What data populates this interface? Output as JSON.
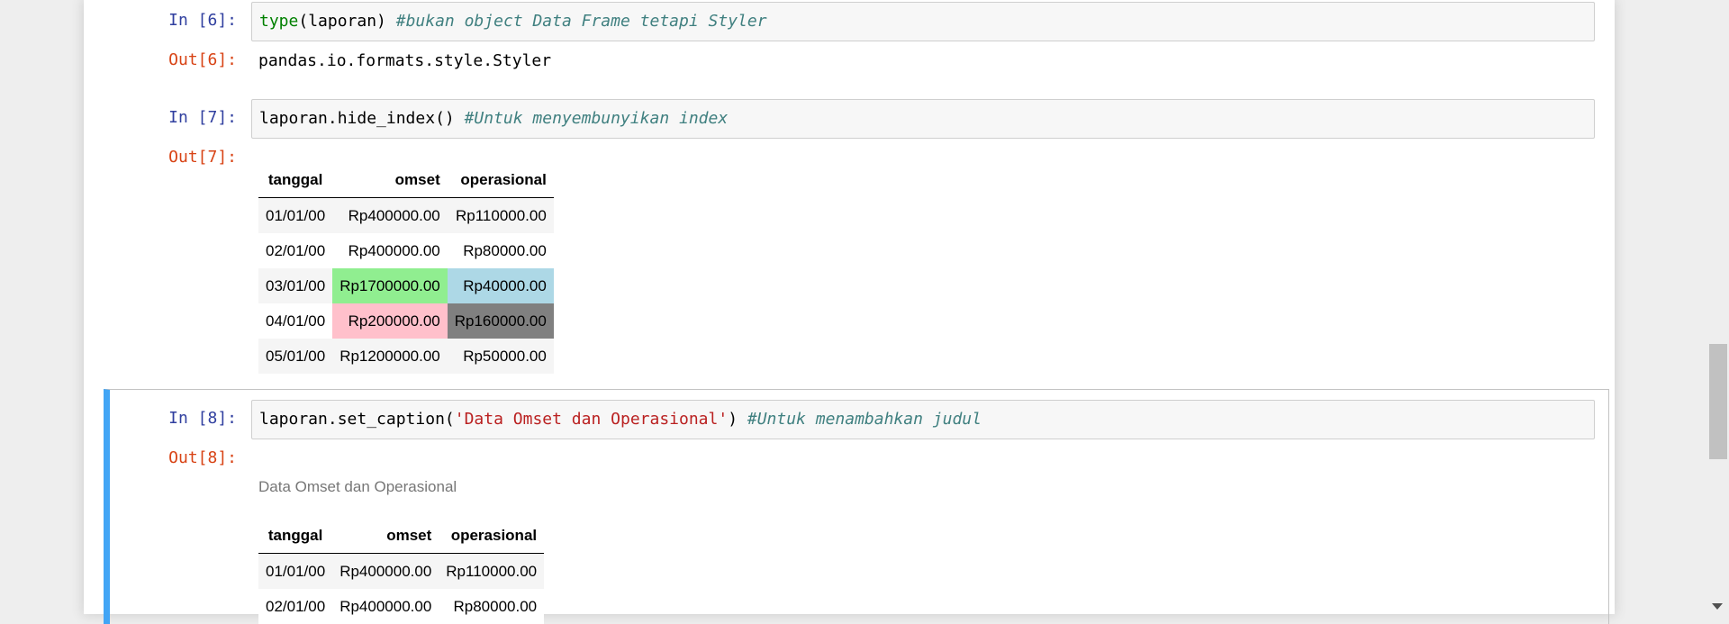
{
  "cells": {
    "c6": {
      "in_prompt": "In [6]:",
      "code_builtin": "type",
      "code_rest": "(laporan) ",
      "code_comment": "#bukan object Data Frame tetapi Styler",
      "out_prompt": "Out[6]:",
      "output_text": "pandas.io.formats.style.Styler"
    },
    "c7": {
      "in_prompt": "In [7]:",
      "code_rest": "laporan.hide_index() ",
      "code_comment": "#Untuk menyembunyikan index",
      "out_prompt": "Out[7]:"
    },
    "c8": {
      "in_prompt": "In [8]:",
      "code_pre": "laporan.set_caption(",
      "code_string": "'Data Omset dan Operasional'",
      "code_post": ") ",
      "code_comment": "#Untuk menambahkan judul",
      "out_prompt": "Out[8]:",
      "caption": "Data Omset dan Operasional"
    }
  },
  "table": {
    "headers": [
      "tanggal",
      "omset",
      "operasional"
    ],
    "rows": [
      [
        "01/01/00",
        "Rp400000.00",
        "Rp110000.00"
      ],
      [
        "02/01/00",
        "Rp400000.00",
        "Rp80000.00"
      ],
      [
        "03/01/00",
        "Rp1700000.00",
        "Rp40000.00"
      ],
      [
        "04/01/00",
        "Rp200000.00",
        "Rp160000.00"
      ],
      [
        "05/01/00",
        "Rp1200000.00",
        "Rp50000.00"
      ]
    ]
  },
  "highlight_colors": {
    "max_omset": "#90ee90",
    "min_omset": "#ffc0cb",
    "min_operasional": "#add8e6",
    "max_operasional": "#808080"
  },
  "scrollbar": {
    "down_icon": "triangle-down-icon"
  }
}
